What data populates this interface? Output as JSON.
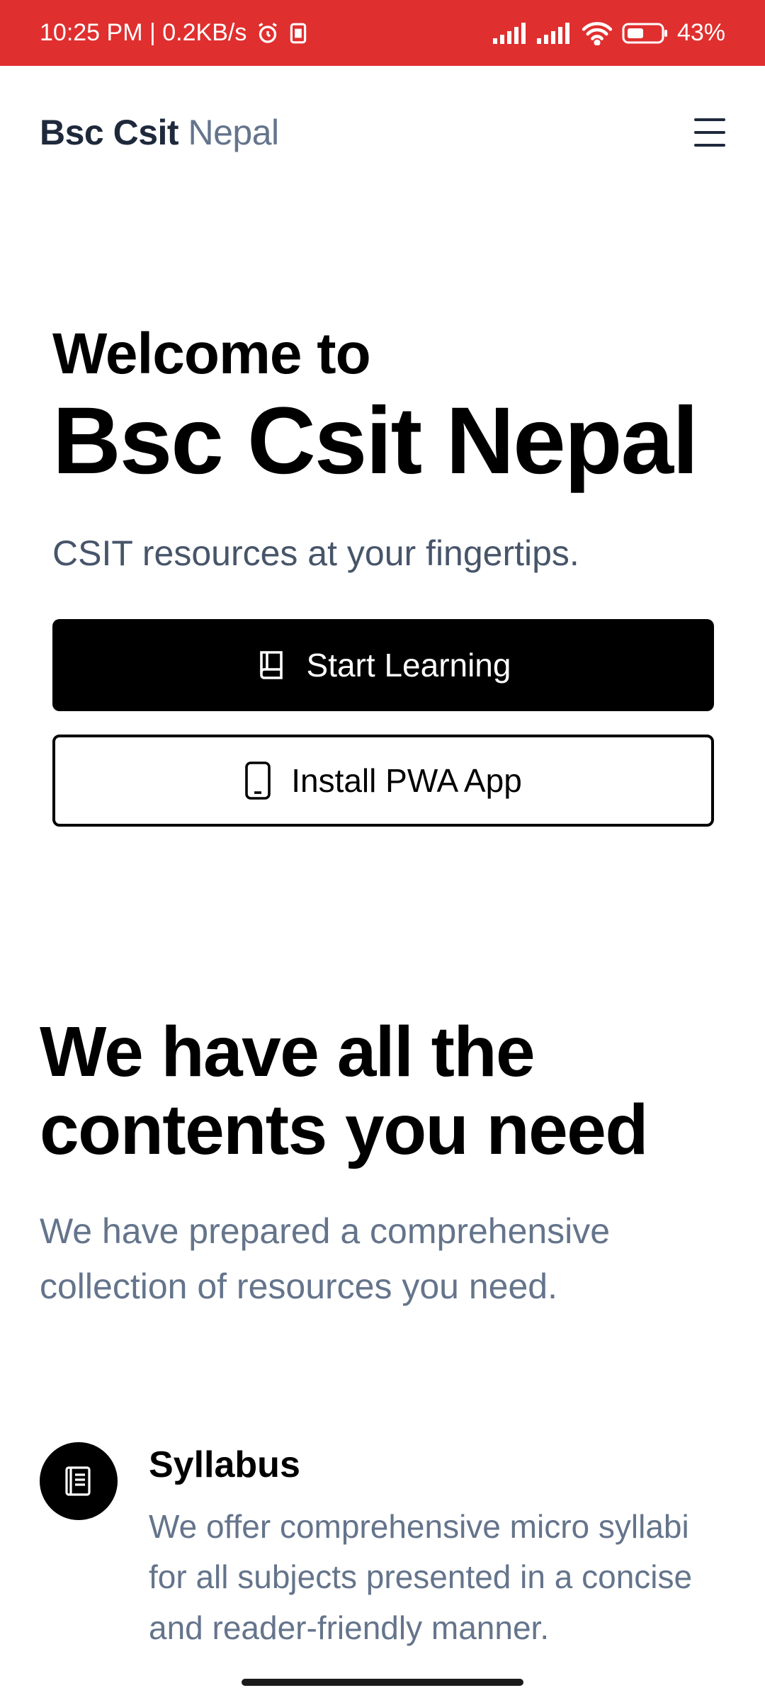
{
  "status_bar": {
    "left_text": "10:25 PM | 0.2KB/s",
    "battery_percent": "43%",
    "icons": [
      "alarm-icon",
      "sim-icon",
      "signal-icon",
      "signal-icon",
      "wifi-icon",
      "battery-icon"
    ],
    "background_color": "#e02f2f"
  },
  "header": {
    "brand_strong": "Bsc Csit",
    "brand_light": "Nepal",
    "menu_icon": "hamburger-menu-icon"
  },
  "hero": {
    "welcome": "Welcome to",
    "title": "Bsc Csit Nepal",
    "subtitle": "CSIT resources at your fingertips."
  },
  "buttons": {
    "start_learning": {
      "label": "Start Learning",
      "icon": "book-icon"
    },
    "install_pwa": {
      "label": "Install PWA App",
      "icon": "phone-icon"
    }
  },
  "section": {
    "title": "We have all the contents you need",
    "subtitle": "We have prepared a comprehensive collection of resources you need."
  },
  "features": [
    {
      "title": "Syllabus",
      "description": "We offer comprehensive micro syllabi for all subjects presented in a concise and reader-friendly manner.",
      "icon": "document-icon"
    }
  ]
}
